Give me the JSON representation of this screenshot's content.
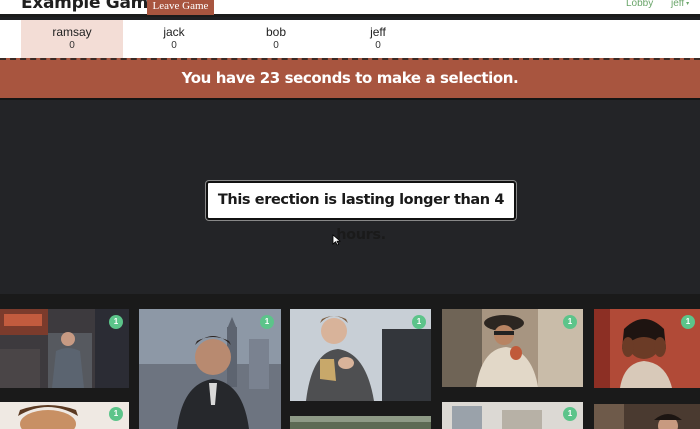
{
  "header": {
    "game_title": "Example Game",
    "leave_label": "Leave Game",
    "nav_lobby": "Lobby",
    "nav_user": "jeff"
  },
  "players": [
    {
      "name": "ramsay",
      "score": "0",
      "active": true
    },
    {
      "name": "jack",
      "score": "0",
      "active": false
    },
    {
      "name": "bob",
      "score": "0",
      "active": false
    },
    {
      "name": "jeff",
      "score": "0",
      "active": false
    }
  ],
  "timer": {
    "text": "You have 23 seconds to make a selection."
  },
  "prompt": {
    "text": "This erection is lasting longer than 4 hours."
  },
  "gifs": [
    {
      "votes": "1",
      "subject": "woman in office"
    },
    {
      "votes": "1",
      "subject": "man in suit"
    },
    {
      "votes": "1",
      "subject": "woman gesturing"
    },
    {
      "votes": "1",
      "subject": "man in hat"
    },
    {
      "votes": "1",
      "subject": "woman with hands on head"
    },
    {
      "votes": "1",
      "subject": "person smiling"
    },
    {
      "votes": "",
      "subject": "landscape"
    },
    {
      "votes": "1",
      "subject": "street scene"
    },
    {
      "votes": "",
      "subject": "people in room"
    }
  ],
  "colors": {
    "accent": "#a8553f",
    "active_tab": "#f3ddd6",
    "badge": "#5cc48a",
    "nav_link": "#6aa56a",
    "stage": "#232427"
  }
}
